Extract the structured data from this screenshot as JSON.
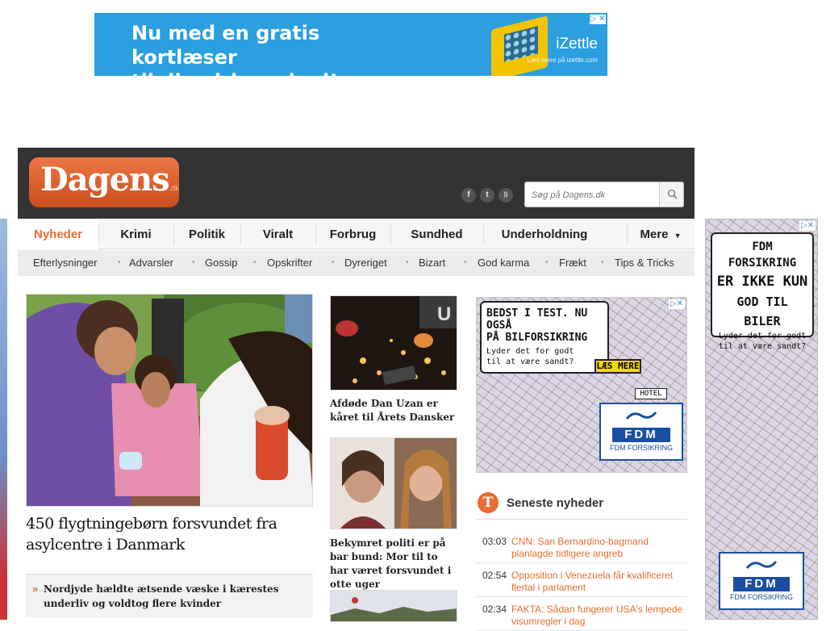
{
  "top_ad": {
    "line1": "Nu med en gratis kortlæser",
    "line2": "til din virksomhed!",
    "brand": "iZettle",
    "brand_sub": "Læs mere på izettle.com",
    "adchoice": "▷ ✕"
  },
  "header": {
    "logo_text": "Dagens",
    "logo_suffix": ".dk",
    "social": [
      "f",
      "t",
      "rss"
    ],
    "search_placeholder": "Søg på Dagens.dk"
  },
  "main_nav": {
    "items": [
      "Nyheder",
      "Krimi",
      "Politik",
      "Viralt",
      "Forbrug",
      "Sundhed",
      "Underholdning"
    ],
    "more": "Mere"
  },
  "sub_nav": {
    "items": [
      "Efterlysninger",
      "Advarsler",
      "Gossip",
      "Opskrifter",
      "Dyreriget",
      "Bizart",
      "God karma",
      "Frækt",
      "Tips & Tricks"
    ]
  },
  "main_article": {
    "title": "450 flygtningebørn forsvundet fra asylcentre i Danmark"
  },
  "sub_story": {
    "text": "Nordjyde hældte ætsende væske i kærestes underliv og voldtog flere kvinder"
  },
  "side_stories": [
    {
      "title": "Afdøde Dan Uzan er kåret til Årets Dansker"
    },
    {
      "title": "Bekymret politi er på bar bund: Mor til to har været forsvundet i otte uger"
    }
  ],
  "mid_ad": {
    "headline1": "BEDST I TEST. NU OGSÅ",
    "headline2": "PÅ BILFORSIKRING",
    "sub1": "Lyder det for godt",
    "sub2": "til at være sandt?",
    "cta": "LÆS MERE",
    "brand_logo": "FDM",
    "brand": "FDM FORSIKRING",
    "hotel": "HOTEL"
  },
  "latest": {
    "title": "Seneste nyheder",
    "icon_letter": "T",
    "items": [
      {
        "time": "03:03",
        "text": "CNN: San Bernardino-bagmand planlagde tidligere angreb"
      },
      {
        "time": "02:54",
        "text": "Opposition i Venezuela får kvalificeret flertal i parlament"
      },
      {
        "time": "02:34",
        "text": "FAKTA: Sådan fungerer USA's lempede visumregler i dag"
      }
    ]
  },
  "right_ad": {
    "line1": "FDM FORSIKRING",
    "line2": "ER IKKE KUN",
    "line3": "GOD TIL BILER",
    "sub1": "Lyder det for godt",
    "sub2": "til at være sandt?",
    "brand_logo": "FDM",
    "brand": "FDM FORSIKRING"
  },
  "colors": {
    "accent": "#e96c2f",
    "header_bg": "#333333",
    "ad_blue": "#2b9fe0",
    "fdm_blue": "#1a4fa0"
  }
}
